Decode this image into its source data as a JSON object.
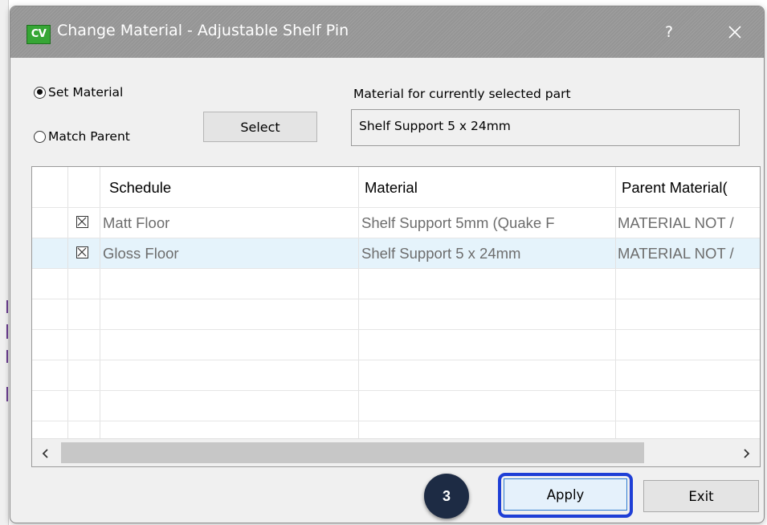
{
  "dialog": {
    "title": "Change Material - Adjustable Shelf Pin",
    "app_icon_label": "CV",
    "help_label": "?",
    "close_icon": "close-icon"
  },
  "options": {
    "set_material_label": "Set Material",
    "set_material_selected": true,
    "match_parent_label": "Match Parent",
    "match_parent_selected": false,
    "select_button_label": "Select"
  },
  "current_material": {
    "label": "Material for currently selected part",
    "value": "Shelf Support 5 x 24mm"
  },
  "grid": {
    "columns": [
      "Schedule",
      "Material",
      "Parent Material("
    ],
    "rows": [
      {
        "checked": true,
        "schedule": "Matt Floor",
        "material": "Shelf Support 5mm (Quake F",
        "parent_material": "MATERIAL NOT /",
        "selected": false
      },
      {
        "checked": true,
        "schedule": "Gloss Floor",
        "material": "Shelf Support 5 x 24mm",
        "parent_material": "MATERIAL NOT /",
        "selected": true
      }
    ],
    "scroll_left_icon": "chevron-left-icon",
    "scroll_right_icon": "chevron-right-icon"
  },
  "footer": {
    "step_number": "3",
    "apply_label": "Apply",
    "exit_label": "Exit"
  },
  "colors": {
    "titlebar": "#9a9a9a",
    "app_icon": "#36a635",
    "selected_row": "#e5f3fb",
    "highlight": "#1f3fd6",
    "step_badge": "#1d2b44"
  }
}
